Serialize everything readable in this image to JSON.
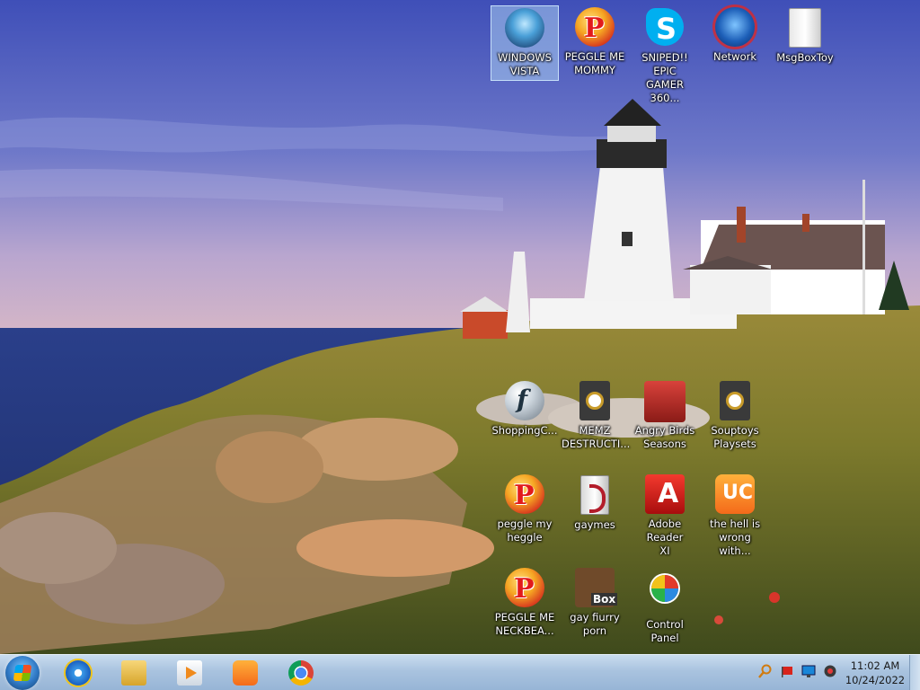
{
  "desktop": {
    "wallpaper": "Pemaquid Point lighthouse at sunset",
    "icons": [
      {
        "label": "WINDOWS\nVISTA",
        "icon": "vista-orb-icon",
        "selected": true
      },
      {
        "label": "PEGGLE ME\nMOMMY",
        "icon": "peggle-icon"
      },
      {
        "label": "SNIPED!! EPIC\nGAMER 360...",
        "icon": "skype-icon"
      },
      {
        "label": "Network",
        "icon": "network-globe-icon"
      },
      {
        "label": "MsgBoxToy",
        "icon": "document-folder-icon"
      },
      {
        "label": "ShoppingC...",
        "icon": "flash-player-icon"
      },
      {
        "label": "MEMZ\nDESTRUCTI...",
        "icon": "shortcut-document-icon"
      },
      {
        "label": "Angry Birds\nSeasons",
        "icon": "angry-birds-icon"
      },
      {
        "label": "Souptoys\nPlaysets",
        "icon": "shortcut-document-icon"
      },
      {
        "label": "peggle my\nheggle",
        "icon": "peggle-icon"
      },
      {
        "label": "gaymes",
        "icon": "folder-document-icon"
      },
      {
        "label": "Adobe Reader\nXI",
        "icon": "adobe-reader-icon"
      },
      {
        "label": "the hell is\nwrong with...",
        "icon": "uc-browser-icon"
      },
      {
        "label": "PEGGLE ME\nNECKBEA...",
        "icon": "peggle-icon"
      },
      {
        "label": "gay fiurry\nporn",
        "icon": "box-dog-icon"
      },
      {
        "label": "Control Panel",
        "icon": "control-panel-icon"
      }
    ]
  },
  "taskbar": {
    "pinned": [
      "internet-explorer-icon",
      "windows-explorer-icon",
      "media-player-icon",
      "uc-browser-icon",
      "chrome-icon"
    ],
    "tray": [
      "search-magnifier-icon",
      "flag-icon",
      "monitor-icon",
      "speaker-icon"
    ],
    "clock": {
      "time": "11:02 AM",
      "date": "10/24/2022"
    }
  }
}
